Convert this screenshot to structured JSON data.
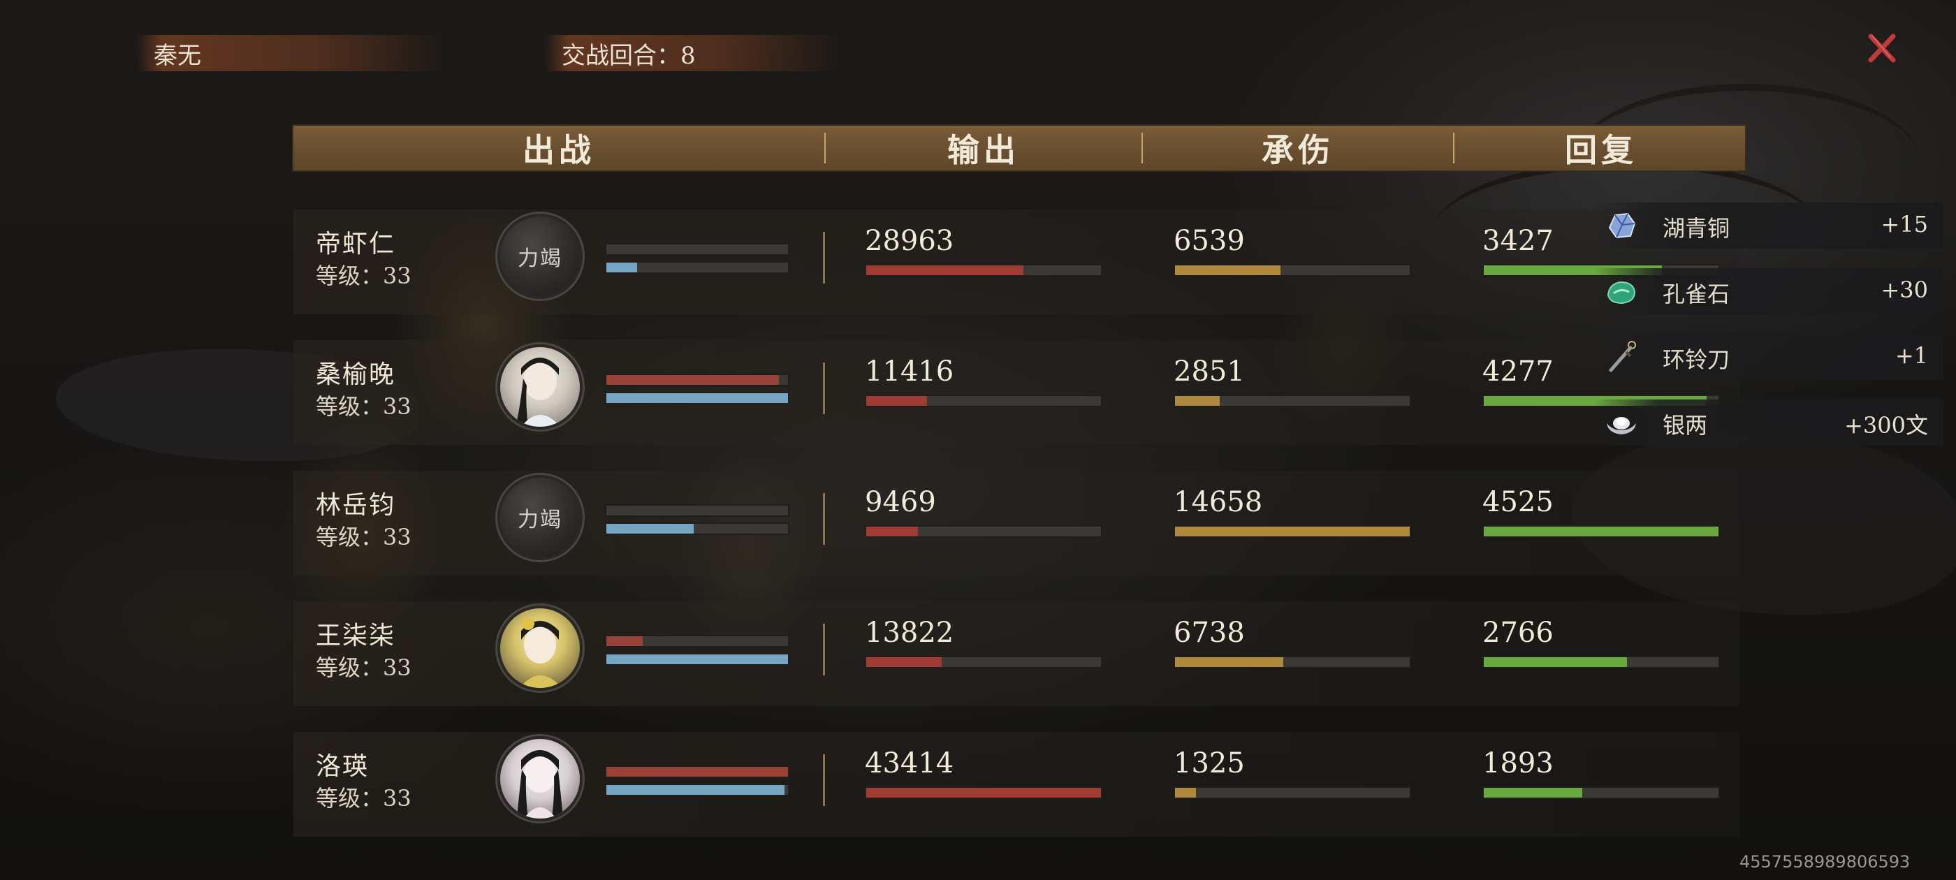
{
  "header": {
    "player_name": "秦无",
    "round_label": "交战回合：8",
    "close_icon": "close-x-icon"
  },
  "columns": {
    "deploy": "出战",
    "output": "输出",
    "damage_taken": "承伤",
    "recovery": "回复"
  },
  "characters": [
    {
      "name": "帝虾仁",
      "level": "等级：33",
      "avatar_text": "力竭",
      "avatar_style": "male",
      "hp_fraction": 0.0,
      "mp_fraction": 0.17,
      "output": "28963",
      "output_fraction": 0.67,
      "damage_taken": "6539",
      "damage_taken_fraction": 0.45,
      "recovery": "3427",
      "recovery_fraction": 0.76
    },
    {
      "name": "桑榆晚",
      "level": "等级：33",
      "avatar_text": "",
      "avatar_style": "female1",
      "hp_fraction": 0.95,
      "mp_fraction": 1.0,
      "output": "11416",
      "output_fraction": 0.26,
      "damage_taken": "2851",
      "damage_taken_fraction": 0.19,
      "recovery": "4277",
      "recovery_fraction": 0.95
    },
    {
      "name": "林岳钧",
      "level": "等级：33",
      "avatar_text": "力竭",
      "avatar_style": "male",
      "hp_fraction": 0.0,
      "mp_fraction": 0.48,
      "output": "9469",
      "output_fraction": 0.22,
      "damage_taken": "14658",
      "damage_taken_fraction": 1.0,
      "recovery": "4525",
      "recovery_fraction": 1.0
    },
    {
      "name": "王柒柒",
      "level": "等级：33",
      "avatar_text": "",
      "avatar_style": "female2",
      "hp_fraction": 0.2,
      "mp_fraction": 1.0,
      "output": "13822",
      "output_fraction": 0.32,
      "damage_taken": "6738",
      "damage_taken_fraction": 0.46,
      "recovery": "2766",
      "recovery_fraction": 0.61
    },
    {
      "name": "洛瑛",
      "level": "等级：33",
      "avatar_text": "",
      "avatar_style": "female3",
      "hp_fraction": 1.0,
      "mp_fraction": 0.98,
      "output": "43414",
      "output_fraction": 1.0,
      "damage_taken": "1325",
      "damage_taken_fraction": 0.09,
      "recovery": "1893",
      "recovery_fraction": 0.42
    }
  ],
  "rewards": [
    {
      "name": "湖青铜",
      "amount": "+15",
      "icon": "bronze-ore-icon"
    },
    {
      "name": "孔雀石",
      "amount": "+30",
      "icon": "malachite-icon"
    },
    {
      "name": "环铃刀",
      "amount": "+1",
      "icon": "ring-blade-icon"
    },
    {
      "name": "银两",
      "amount": "+300文",
      "icon": "silver-ingot-icon"
    }
  ],
  "footer": {
    "id_code": "4557558989806593"
  },
  "colors": {
    "output_bar": "#9f3b33",
    "damage_bar": "#b08a3c",
    "recovery_bar": "#69a93f",
    "hp_bar": "#9b4238",
    "mp_bar": "#76a6c4",
    "header_bar": "#6a5030",
    "close_icon": "#c0393b"
  }
}
